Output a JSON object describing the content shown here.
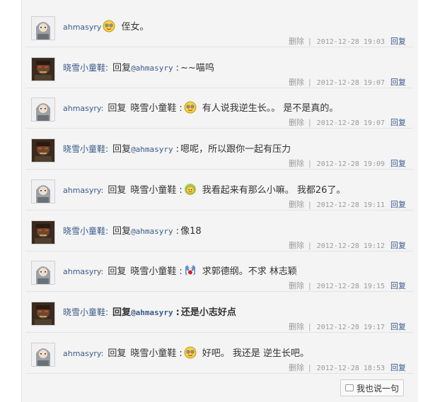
{
  "comments": [
    {
      "author": "ahmasyry",
      "author_type": "en",
      "reply_label": "",
      "target": "",
      "mention": "",
      "colon": "",
      "emoji": "smile-face",
      "text": "侄女。",
      "delete": "删除",
      "sep": "|",
      "time": "2012-12-28 19:03",
      "reply": "回复",
      "bold": false
    },
    {
      "author": "晓雪小童鞋:",
      "author_type": "cn",
      "reply_label": "回复",
      "target": "",
      "mention": "@ahmasyry",
      "colon": ":",
      "emoji": "",
      "text": "~~喵呜",
      "delete": "删除",
      "sep": "|",
      "time": "2012-12-28 19:07",
      "reply": "回复",
      "bold": false
    },
    {
      "author": "ahmasyry:",
      "author_type": "en",
      "reply_label": "回复",
      "target": "晓雪小童鞋",
      "mention": "",
      "colon": ":",
      "emoji": "smile-face",
      "text": "有人说我逆生长。。  是不是真的。",
      "delete": "删除",
      "sep": "|",
      "time": "2012-12-28 19:07",
      "reply": "回复",
      "bold": false
    },
    {
      "author": "晓雪小童鞋:",
      "author_type": "cn",
      "reply_label": "回复",
      "target": "",
      "mention": "@ahmasyry",
      "colon": ":",
      "emoji": "",
      "text": "嗯呢，所以跟你一起有压力",
      "delete": "删除",
      "sep": "|",
      "time": "2012-12-28 19:09",
      "reply": "回复",
      "bold": false
    },
    {
      "author": "ahmasyry:",
      "author_type": "en",
      "reply_label": "回复",
      "target": "晓雪小童鞋",
      "mention": "",
      "colon": ":",
      "emoji": "sun-face",
      "text": "我看起来有那么小嘛。  我都26了。",
      "delete": "删除",
      "sep": "|",
      "time": "2012-12-28 19:11",
      "reply": "回复",
      "bold": false
    },
    {
      "author": "晓雪小童鞋:",
      "author_type": "cn",
      "reply_label": "回复",
      "target": "",
      "mention": "@ahmasyry",
      "colon": ":",
      "emoji": "",
      "text": "像18",
      "delete": "删除",
      "sep": "|",
      "time": "2012-12-28 19:12",
      "reply": "回复",
      "bold": false
    },
    {
      "author": "ahmasyry:",
      "author_type": "en",
      "reply_label": "回复",
      "target": "晓雪小童鞋",
      "mention": "",
      "colon": ":",
      "emoji": "cat-face",
      "text": "求郭德纲。不求 林志颖",
      "delete": "删除",
      "sep": "|",
      "time": "2012-12-28 19:15",
      "reply": "回复",
      "bold": false
    },
    {
      "author": "晓雪小童鞋:",
      "author_type": "cn",
      "reply_label": "回复",
      "target": "",
      "mention": "@ahmasyry",
      "colon": ":",
      "emoji": "",
      "text": "还是小志好点",
      "delete": "删除",
      "sep": "|",
      "time": "2012-12-28 19:17",
      "reply": "回复",
      "bold": true
    },
    {
      "author": "ahmasyry:",
      "author_type": "en",
      "reply_label": "回复",
      "target": "晓雪小童鞋",
      "mention": "",
      "colon": ":",
      "emoji": "smile-face",
      "text": "好吧。  我还是 逆生长吧。",
      "delete": "删除",
      "sep": "|",
      "time": "2012-12-28 18:53",
      "reply": "回复",
      "bold": false
    }
  ],
  "say_button": "我也说一句",
  "colors": {
    "link": "#3a5a8a",
    "meta": "#9a9a9a",
    "panel": "#f4f4f4"
  }
}
